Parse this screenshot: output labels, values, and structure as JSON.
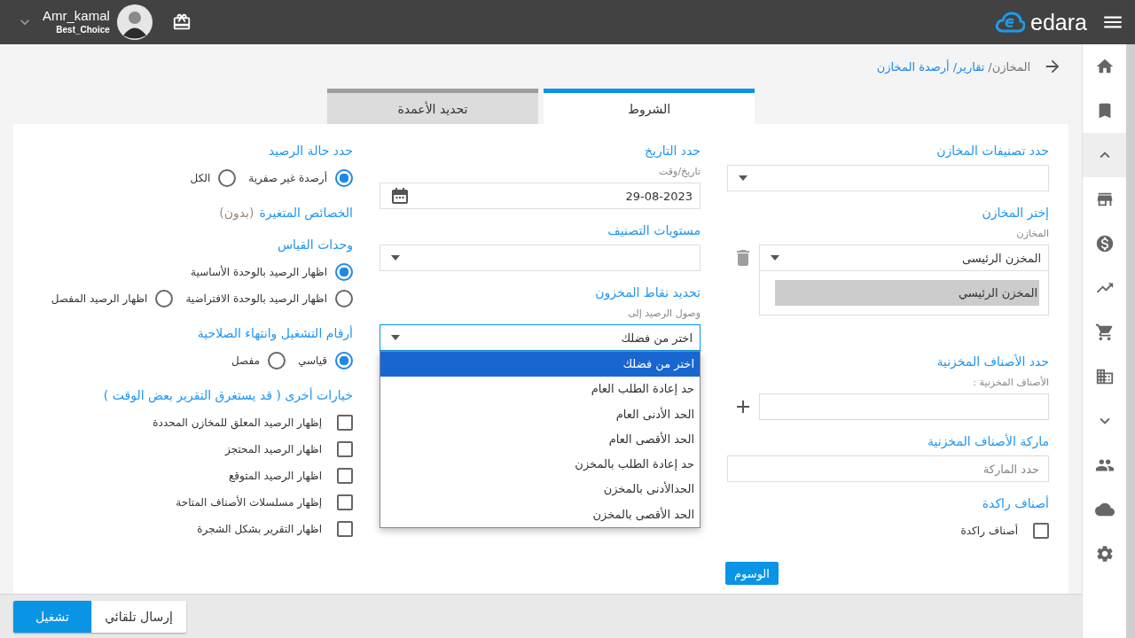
{
  "header": {
    "user_name": "Amr_kamal",
    "user_role": "Best_Choice",
    "brand": "edara"
  },
  "breadcrumb": [
    "المخازن/",
    "تقارير/",
    "أرصدة المخازن"
  ],
  "tabs": [
    {
      "label": "الشروط",
      "selected": true
    },
    {
      "label": "تحديد الأعمدة",
      "selected": false
    }
  ],
  "columns": [
    [
      {
        "title": "حدد تصنيفات المخازن",
        "fields": [
          {
            "kind": "select"
          }
        ]
      },
      {
        "title": "إختر المخازن",
        "fields": [
          {
            "kind": "select",
            "label": "المخازن",
            "value": "المخزن الرئيسى",
            "deletable": true
          },
          {
            "kind": "listbox",
            "items": [
              {
                "label": "المخزن الرئيسي",
                "selected": true
              }
            ]
          }
        ]
      },
      {
        "title": "حدد الأصناف المخزنية",
        "fields": [
          {
            "kind": "input",
            "label": "الأصناف المخزنية :",
            "addable": true
          }
        ]
      },
      {
        "title": "ماركة الأصناف المخزنية",
        "fields": [
          {
            "kind": "input",
            "placeholder": "حدد الماركة"
          }
        ]
      },
      {
        "title": "أصناف راكدة",
        "fields": [
          {
            "kind": "checkbox",
            "label": "أصناف راكدة",
            "checked": false
          }
        ]
      },
      {
        "fields": [
          {
            "kind": "button",
            "label": "الوسوم"
          }
        ]
      }
    ],
    [
      {
        "title": "حدد التاريخ",
        "fields": [
          {
            "kind": "date",
            "label": "تاريخ/وقت",
            "value": "29-08-2023"
          }
        ]
      },
      {
        "title": "مستويات التصنيف",
        "fields": [
          {
            "kind": "select"
          }
        ]
      },
      {
        "title": "تحديد نقاط المخزون",
        "fields": [
          {
            "kind": "select",
            "label": "وصول الرصيد إلى",
            "value": "اختر من فضلك",
            "open": true,
            "options": [
              {
                "label": "اختر من فضلك",
                "selected": true
              },
              {
                "label": "حد إعادة الطلب العام",
                "selected": false
              },
              {
                "label": "الحد الأدنى العام",
                "selected": false
              },
              {
                "label": "الحد الأقصى العام",
                "selected": false
              },
              {
                "label": "حد إعادة الطلب بالمخزن",
                "selected": false
              },
              {
                "label": "الحدالأدنى بالمخزن",
                "selected": false
              },
              {
                "label": "الحد الأقصى بالمخزن",
                "selected": false
              }
            ]
          }
        ]
      }
    ],
    [
      {
        "title": "حدد حالة الرصيد",
        "fields": [
          {
            "kind": "radios",
            "rows": [
              [
                {
                  "label": "أرصدة غير صفرية",
                  "selected": true
                },
                {
                  "label": "الكل",
                  "selected": false
                }
              ]
            ]
          }
        ]
      },
      {
        "title": "الخصائص المتغيرة",
        "note": "(بدون)"
      },
      {
        "title": "وحدات القياس",
        "fields": [
          {
            "kind": "radios",
            "rows": [
              [
                {
                  "label": "اظهار الرصيد بالوحدة الأساسية",
                  "selected": true
                }
              ],
              [
                {
                  "label": "اظهار الرصيد بالوحدة الافتراضية",
                  "selected": false
                },
                {
                  "label": "اظهار الرصيد المفصل",
                  "selected": false
                }
              ]
            ]
          }
        ]
      },
      {
        "title": "أرقام التشغيل وانتهاء الصلاحية",
        "fields": [
          {
            "kind": "radios",
            "rows": [
              [
                {
                  "label": "قياسي",
                  "selected": true
                },
                {
                  "label": "مفصل",
                  "selected": false
                }
              ]
            ]
          }
        ]
      },
      {
        "title": "خيارات أخرى ( قد يستغرق التقرير بعض الوقت )",
        "fields": [
          {
            "kind": "checkbox",
            "label": "إظهار الرصيد المعلق للمخازن المحددة",
            "checked": false
          },
          {
            "kind": "checkbox",
            "label": "اظهار الرصيد المحتجز",
            "checked": false
          },
          {
            "kind": "checkbox",
            "label": "اظهار الرصيد المتوقع",
            "checked": false
          },
          {
            "kind": "checkbox",
            "label": "إظهار مسلسلات الأصناف المتاحة",
            "checked": false
          },
          {
            "kind": "checkbox",
            "label": "اظهار التقرير بشكل الشجرة",
            "checked": false
          }
        ]
      }
    ]
  ],
  "footer": {
    "buttons": [
      {
        "label": "إرسال تلقائي",
        "kind": "secondary"
      },
      {
        "label": "تشغيل",
        "kind": "primary"
      }
    ]
  }
}
